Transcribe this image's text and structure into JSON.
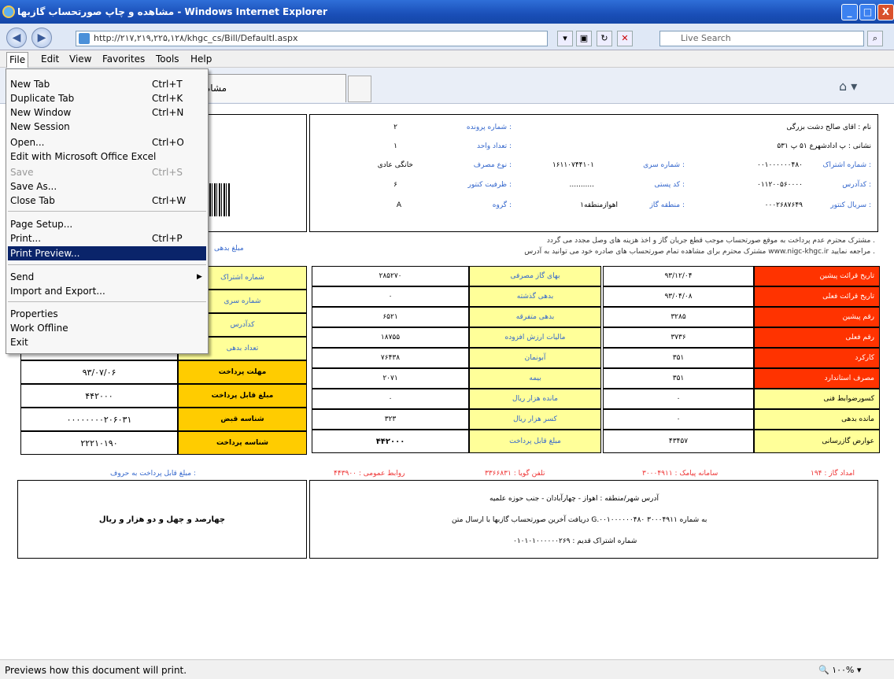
{
  "window": {
    "title": "مشاهده و چاپ صورتحساب گازبها - Windows Internet Explorer",
    "min": "_",
    "max": "□",
    "close": "X"
  },
  "address": {
    "url": "http://۲۱۷,۲۱۹,۲۲۵,۱۲۸/khgc_cs/Bill/DefaultI.aspx",
    "search_placeholder": "Live Search"
  },
  "menubar": [
    "File",
    "Edit",
    "View",
    "Favorites",
    "Tools",
    "Help"
  ],
  "tab": {
    "label": "مشاه"
  },
  "file_menu": {
    "items": [
      {
        "label": "New Tab",
        "shortcut": "Ctrl+T"
      },
      {
        "label": "Duplicate Tab",
        "shortcut": "Ctrl+K"
      },
      {
        "label": "New Window",
        "shortcut": "Ctrl+N"
      },
      {
        "label": "New Session",
        "shortcut": ""
      },
      {
        "label": "Open...",
        "shortcut": "Ctrl+O"
      },
      {
        "label": "Edit with Microsoft Office Excel",
        "shortcut": ""
      },
      {
        "label": "Save",
        "shortcut": "Ctrl+S"
      },
      {
        "label": "Save As...",
        "shortcut": ""
      },
      {
        "label": "Close Tab",
        "shortcut": "Ctrl+W"
      },
      {
        "label": "Page Setup...",
        "shortcut": ""
      },
      {
        "label": "Print...",
        "shortcut": "Ctrl+P"
      },
      {
        "label": "Print Preview...",
        "shortcut": ""
      },
      {
        "label": "Send",
        "shortcut": ""
      },
      {
        "label": "Import and Export...",
        "shortcut": ""
      },
      {
        "label": "Properties",
        "shortcut": ""
      },
      {
        "label": "Work Offline",
        "shortcut": ""
      },
      {
        "label": "Exit",
        "shortcut": ""
      }
    ]
  },
  "bill": {
    "info": {
      "name": "نام : اقای صالح دشت بزرگی",
      "address": "نشانی : پ ادادشهرع ۵۱ پ ۵۳۱",
      "file_no_label": "شماره پرونده :",
      "file_no": "۲",
      "units_label": "تعداد واحد :",
      "units": "۱",
      "usage_label": "نوع مصرف :",
      "usage": "خانگی عادی",
      "serial_label": "شماره سری :",
      "serial": "۱۶۱۱۰۷۴۴۱۰۱",
      "account_label": "شماره اشتراک :",
      "account": "۰۰۱۰۰۰۰۰۰۴۸۰",
      "capacity_label": "ظرفیت کنتور :",
      "capacity": "۶",
      "postal_label": "کد پستی :",
      "postal": "...........",
      "address_code_label": "کدآدرس :",
      "address_code": "۰۱۱۲۰۰۵۶۰۰۰۰",
      "group_label": "گروه :",
      "group": "A",
      "region_label": "منطقه گاز :",
      "region": "اهوازمنطقه۱",
      "meter_label": "سریال کنتور :",
      "meter": "۰۰۰۲۶۸۷۶۴۹"
    },
    "notice1": "مشترک محترم عدم پرداخت به موقع صورتحساب موجب قطع جریان گاز و اخذ هزینه های وصل مجدد می گردد .",
    "notice2": "مشترک محترم برای مشاهده تمام صورتحساب های صادره خود می توانید به آدرس www.nigc-khgc.ir مراجعه نمایید .",
    "debt_label": "مبلغ بدهی",
    "left_labels": [
      "شماره اشتراک",
      "شماره سری",
      "کدآدرس",
      "تعداد بدهی"
    ],
    "due": {
      "label": "مهلت پرداخت",
      "value": "۹۳/۰۷/۰۶"
    },
    "payable": {
      "label": "مبلغ قابل پرداخت",
      "value": "۴۴۲۰۰۰"
    },
    "bill_id": {
      "label": "شناسه قبض",
      "value": "۰۰۰۰۰۰۰۰۲۰۶۰۳۱"
    },
    "pay_id": {
      "label": "شناسه پرداخت",
      "value": "۲۲۲۱۰۱۹۰"
    },
    "middle": [
      {
        "label": "بهای گاز مصرفی",
        "value": "۲۸۵۲۷۰"
      },
      {
        "label": "بدهی گذشته",
        "value": "۰"
      },
      {
        "label": "بدهی متفرقه",
        "value": "۶۵۲۱"
      },
      {
        "label": "مالیات ارزش افزوده",
        "value": "۱۸۷۵۵"
      },
      {
        "label": "آبونمان",
        "value": "۷۶۴۳۸"
      },
      {
        "label": "بیمه",
        "value": "۲۰۷۱"
      },
      {
        "label": "مانده هزار ریال",
        "value": "۰"
      },
      {
        "label": "کسر هزار ریال",
        "value": "۳۲۳"
      },
      {
        "label": "مبلغ قابل پرداخت",
        "value": "۴۴۲۰۰۰"
      }
    ],
    "right": [
      {
        "label": "تاریخ قرائت پیشین",
        "value": "۹۳/۱۲/۰۴"
      },
      {
        "label": "تاریخ قرائت فعلی",
        "value": "۹۳/۰۴/۰۸"
      },
      {
        "label": "رقم پیشین",
        "value": "۳۲۸۵"
      },
      {
        "label": "رقم فعلی",
        "value": "۳۷۳۶"
      },
      {
        "label": "کارکرد",
        "value": "۳۵۱"
      },
      {
        "label": "مصرف استاندارد",
        "value": "۳۵۱"
      },
      {
        "label": "کسورضوابط فنی",
        "value": "۰"
      },
      {
        "label": "مانده بدهی",
        "value": "۰"
      },
      {
        "label": "عوارض گازرسانی",
        "value": "۴۳۴۵۷"
      }
    ],
    "footer": {
      "amount_words_label": "مبلغ قابل پرداخت به حروف :",
      "public_rel": "روابط عمومی : ۴۴۳۹۰۰",
      "voice_phone": "تلفن گویا : ۳۳۶۶۸۳۱",
      "sms": "سامانه پیامک : ۳۰۰۰۴۹۱۱",
      "emergency": "امداد گاز : ۱۹۴",
      "amount_words": "چهارصد و چهل و دو هزار و ریال",
      "address_line": "آدرس شهر/منطقه : اهواز - چهارآبادان - جنب حوزه علمیه",
      "sms_line": "دریافت آخرین صورتحساب گازبها با ارسال متن G.۰۰۱۰۰۰۰۰۰۴۸۰ به شماره ۳۰۰۰۴۹۱۱",
      "old_account": "شماره اشتراک قدیم : ۰۱۰۱۰۱۰۰۰۰۰۰۲۶۹"
    }
  },
  "status": {
    "text": "Previews how this document will print.",
    "zoom": "۱۰۰%"
  }
}
